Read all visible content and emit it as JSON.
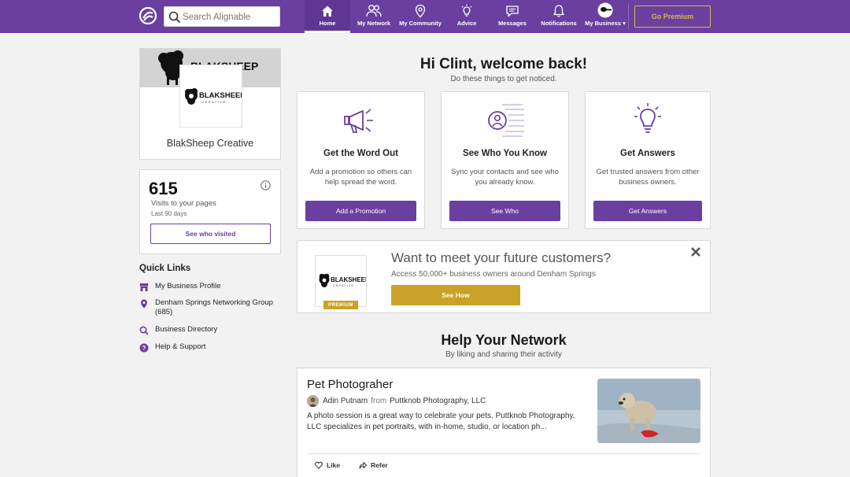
{
  "header": {
    "search_placeholder": "Search Alignable",
    "nav": [
      {
        "label": "Home",
        "icon": "home-icon"
      },
      {
        "label": "My Network",
        "icon": "people-icon"
      },
      {
        "label": "My Community",
        "icon": "location-pin-icon"
      },
      {
        "label": "Advice",
        "icon": "lightbulb-icon"
      },
      {
        "label": "Messages",
        "icon": "chat-bubble-icon"
      },
      {
        "label": "Notifications",
        "icon": "bell-icon"
      },
      {
        "label": "My Business",
        "icon": "business-avatar-icon"
      }
    ],
    "premium_label": "Go Premium",
    "colors": {
      "bar": "#6a3fa0",
      "gold": "#c9a227"
    }
  },
  "profile": {
    "business_name": "BlakSheep Creative",
    "logo_word": "BLAKSHEEP",
    "logo_sub": "CREATIVE"
  },
  "stats": {
    "visits": "615",
    "label": "Visits to your pages",
    "period": "Last 90 days",
    "button": "See who visited"
  },
  "quick_links": {
    "title": "Quick Links",
    "items": [
      {
        "label": "My Business Profile",
        "icon": "storefront-icon"
      },
      {
        "label": "Denham Springs Networking Group (685)",
        "icon": "location-pin-icon"
      },
      {
        "label": "Business Directory",
        "icon": "search-icon"
      },
      {
        "label": "Help & Support",
        "icon": "help-icon"
      }
    ]
  },
  "welcome": {
    "title": "Hi Clint, welcome back!",
    "subtitle": "Do these things to get noticed."
  },
  "actions": [
    {
      "title": "Get the Word Out",
      "desc": "Add a promotion so others can help spread the word.",
      "button": "Add a Promotion",
      "icon": "megaphone-icon"
    },
    {
      "title": "See Who You Know",
      "desc": "Sync your contacts and see who you already know.",
      "button": "See Who",
      "icon": "contact-list-icon"
    },
    {
      "title": "Get Answers",
      "desc": "Get trusted answers from other business owners.",
      "button": "Get Answers",
      "icon": "lightbulb-icon"
    }
  ],
  "promo": {
    "title": "Want to meet your future customers?",
    "subtitle": "Access 50,000+ business owners around Denham Springs",
    "button": "See How",
    "badge": "PREMIUM",
    "logo_word": "BLAKSHEEP",
    "logo_sub": "CREATIVE"
  },
  "help": {
    "title": "Help Your Network",
    "subtitle": "By liking and sharing their activity"
  },
  "post": {
    "title": "Pet Photograher",
    "author": "Adin Putnam",
    "from_word": "from",
    "company": "Puttknob Photography, LLC",
    "body": "A photo session is a great way to celebrate your pets. Puttknob Photography, LLC specializes in pet portraits, with in-home, studio, or location ph...",
    "like_label": "Like",
    "refer_label": "Refer"
  }
}
